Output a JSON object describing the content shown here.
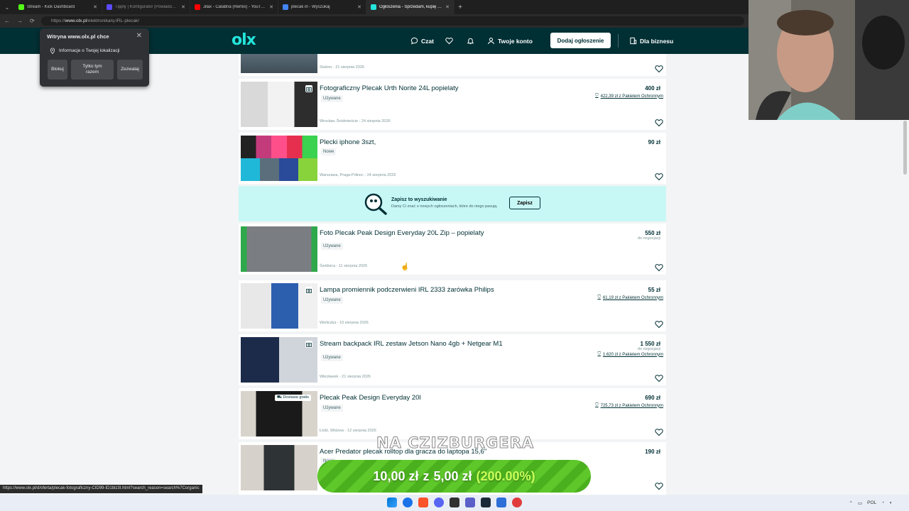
{
  "browser": {
    "tabs": [
      {
        "title": "Stream - Kick Dashboard",
        "color": "#53fc18",
        "active": false
      },
      {
        "title": "Tipply | Konfigurator (Powiadomi...",
        "color": "#5d4bff",
        "active": false
      },
      {
        "title": "Jilax - Calabria (Remix) - YouTube",
        "color": "#ff0000",
        "active": false
      },
      {
        "title": "plecak irl - Wyszukaj",
        "color": "#4285f4",
        "active": false
      },
      {
        "title": "Ogłoszenia - Sprzedam, kupię na ...",
        "color": "#23e5db",
        "active": true
      }
    ],
    "url_prefix": "https://",
    "url_host": "www.olx.pl",
    "url_path": "/elektronika/q-IRL-plecak/",
    "status_url": "https://www.olx.pl/d/oferta/plecak-fotograficzny-CID99-ID1blz3I.html?search_reason=search%7Corganic"
  },
  "popup": {
    "title": "Witryna www.olx.pl chce",
    "location_text": "Informacje o Twojej lokalizacji",
    "block_label": "Blokuj",
    "once_label": "Tylko tym razem",
    "allow_label": "Zezwalaj"
  },
  "header": {
    "logo": "olx",
    "chat_label": "Czat",
    "account_label": "Twoje konto",
    "add_label": "Dodaj ogłoszenie",
    "business_label": "Dla biznesu"
  },
  "listings": [
    {
      "title": "",
      "condition": "",
      "location_date": "Stubno - 21 sierpnia 2026",
      "price": "",
      "protection": "",
      "negotiable": ""
    },
    {
      "title": "Fotograficzny Plecak Urth Norite 24L popielaty",
      "condition": "Używane",
      "location_date": "Wrocław, Śródmieście - 24 sierpnia 2026",
      "price": "400 zł",
      "protection": "422,39 zł z Pakietem Ochronnym",
      "negotiable": ""
    },
    {
      "title": "Plecki iphone 3szt,",
      "condition": "Nowe",
      "location_date": "Warszawa, Praga-Północ - 24 sierpnia 2026",
      "price": "90 zł",
      "protection": "",
      "negotiable": ""
    },
    {
      "title": "Foto Plecak Peak Design Everyday 20L Zip – popielaty",
      "condition": "Używane",
      "location_date": "Świdnica - 11 sierpnia 2026",
      "price": "550 zł",
      "protection": "",
      "negotiable": "do negocjacji"
    },
    {
      "title": "Lampa promiennik podczerwieni IRL 2333 żarówka Philips",
      "condition": "Używane",
      "location_date": "Wieliczka - 10 sierpnia 2026",
      "price": "55 zł",
      "protection": "61,19 zł z Pakietem Ochronnym",
      "negotiable": ""
    },
    {
      "title": "Stream backpack IRL zestaw Jetson Nano 4gb + Netgear M1",
      "condition": "Używane",
      "location_date": "Włocławek - 21 sierpnia 2026",
      "price": "1 550 zł",
      "protection": "1.620 zł z Pakietem Ochronnym",
      "negotiable": "do negocjacji"
    },
    {
      "title": "Plecak Peak Design Everyday 20l",
      "condition": "Używane",
      "location_date": "Łódź, Widzew - 12 sierpnia 2026",
      "price": "690 zł",
      "protection": "725,73 zł z Pakietem Ochronnym",
      "negotiable": "",
      "badge": "Dostawa gratis"
    },
    {
      "title": "Acer Predator plecak rolltop dla gracza do laptopa 15,6\"",
      "condition": "Nowe",
      "location_date": "",
      "price": "190 zł",
      "protection": "",
      "negotiable": ""
    }
  ],
  "save_search": {
    "title": "Zapisz to wyszukiwanie",
    "subtitle": "Damy Ci znać o nowych ogłoszeniach, które do niego pasują.",
    "button": "Zapisz"
  },
  "overlay": {
    "caption": "NA CZIZBURGERA",
    "donation_current": "10,00 zł",
    "donation_sep": "z",
    "donation_goal": "5,00 zł",
    "donation_pct": "(200.00%)"
  },
  "tray": {
    "lang": "POL"
  },
  "colors": {
    "olx_dark": "#002f34",
    "olx_accent": "#23e5db",
    "save_bg": "#c8f8f6"
  }
}
